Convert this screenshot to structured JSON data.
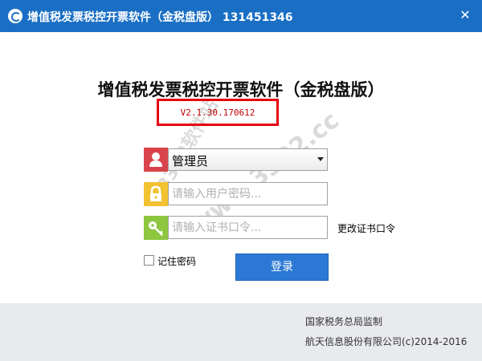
{
  "window": {
    "title": "增值税发票税控开票软件（金税盘版） 131451346",
    "close_symbol": "✕"
  },
  "app": {
    "title": "增值税发票税控开票软件（金税盘版）",
    "version": "V2.1.30.170612"
  },
  "form": {
    "user_selected": "管理员",
    "password_placeholder": "请输入用户密码...",
    "cert_placeholder": "请输入证书口令...",
    "change_cert_label": "更改证书口令",
    "remember_label": "记住密码",
    "remember_checked": false,
    "login_label": "登录"
  },
  "footer": {
    "line1": "国家税务总局监制",
    "line2": "航天信息股份有限公司(c)2014-2016"
  },
  "watermark": {
    "text": "www.3322.cc",
    "text2": "3322软件站"
  },
  "colors": {
    "titlebar": "#1a6fc4",
    "version_border": "#e60012",
    "user_icon_bg": "#d9444c",
    "lock_icon_bg": "#f2c230",
    "key_icon_bg": "#8dc63f",
    "login_button": "#2b79d4",
    "footer_bg": "#e9eaee"
  },
  "icons": {
    "app": "app-logo-icon",
    "user": "user-icon",
    "lock": "lock-icon",
    "key": "key-icon",
    "dropdown": "chevron-down-icon",
    "close": "close-icon"
  }
}
